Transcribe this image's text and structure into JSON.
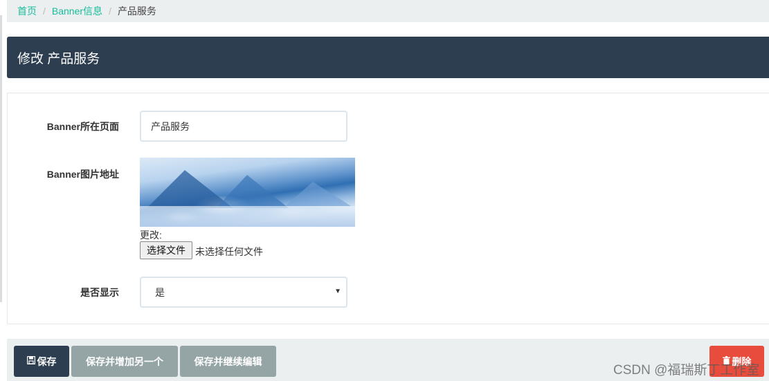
{
  "breadcrumb": {
    "home": "首页",
    "parent": "Banner信息",
    "current": "产品服务",
    "separator": "/"
  },
  "header": {
    "title": "修改 产品服务"
  },
  "form": {
    "page_label": "Banner所在页面",
    "page_value": "产品服务",
    "image_label": "Banner图片地址",
    "change_label": "更改:",
    "file_button": "选择文件",
    "file_status": "未选择任何文件",
    "display_label": "是否显示",
    "display_value": "是"
  },
  "actions": {
    "save": "保存",
    "save_add": "保存并增加另一个",
    "save_continue": "保存并继续编辑",
    "delete": "删除"
  },
  "watermark": "CSDN @福瑞斯丁工作室",
  "colors": {
    "accent": "#18bc9c",
    "header": "#2c3e50",
    "secondary": "#95a5a6",
    "danger": "#e74c3c"
  }
}
